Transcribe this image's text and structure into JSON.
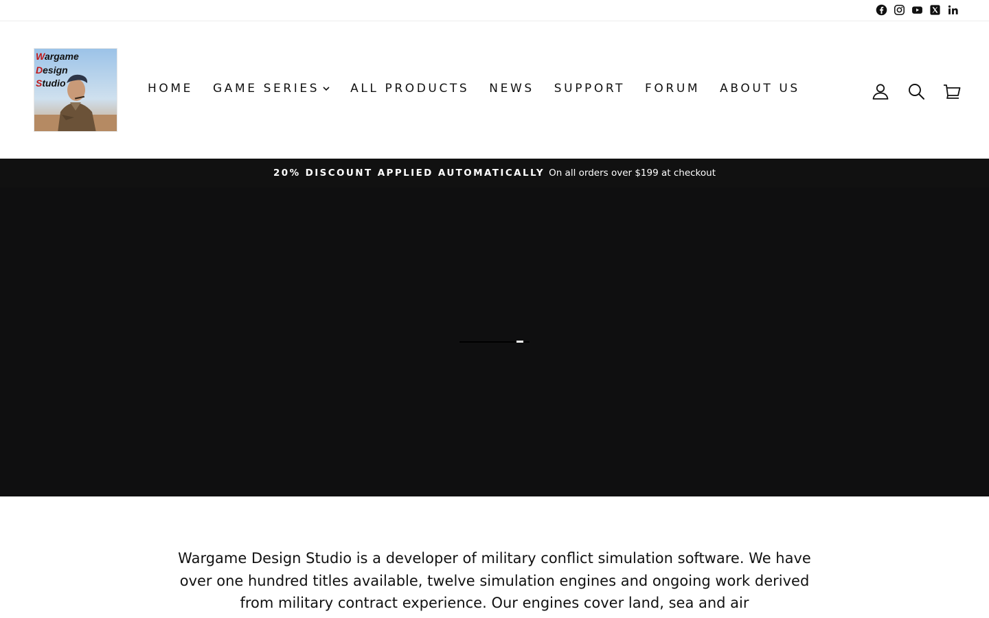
{
  "social": {
    "icons": [
      "facebook-icon",
      "instagram-icon",
      "youtube-icon",
      "x-icon",
      "linkedin-icon"
    ]
  },
  "logo": {
    "lines": [
      "Wargame",
      "Design",
      "Studio"
    ]
  },
  "nav": {
    "items": [
      {
        "label": "HOME"
      },
      {
        "label": "GAME SERIES",
        "has_dropdown": true
      },
      {
        "label": "ALL PRODUCTS"
      },
      {
        "label": "NEWS"
      },
      {
        "label": "SUPPORT"
      },
      {
        "label": "FORUM"
      },
      {
        "label": "ABOUT US"
      }
    ]
  },
  "header_icons": [
    "user-icon",
    "search-icon",
    "cart-icon"
  ],
  "promo": {
    "highlight": "20% DISCOUNT APPLIED AUTOMATICALLY",
    "text": "On all orders over $199 at checkout"
  },
  "loader": {
    "progress": 0.9
  },
  "intro": {
    "text": "Wargame Design Studio is a developer of military conflict simulation software. We have over one hundred titles available, twelve simulation engines and ongoing work derived from military contract experience. Our engines cover land, sea and air"
  },
  "colors": {
    "hero_bg": "#0f0f10",
    "promo_bg": "#111111",
    "text": "#111111",
    "logo_red": "#c01818"
  }
}
